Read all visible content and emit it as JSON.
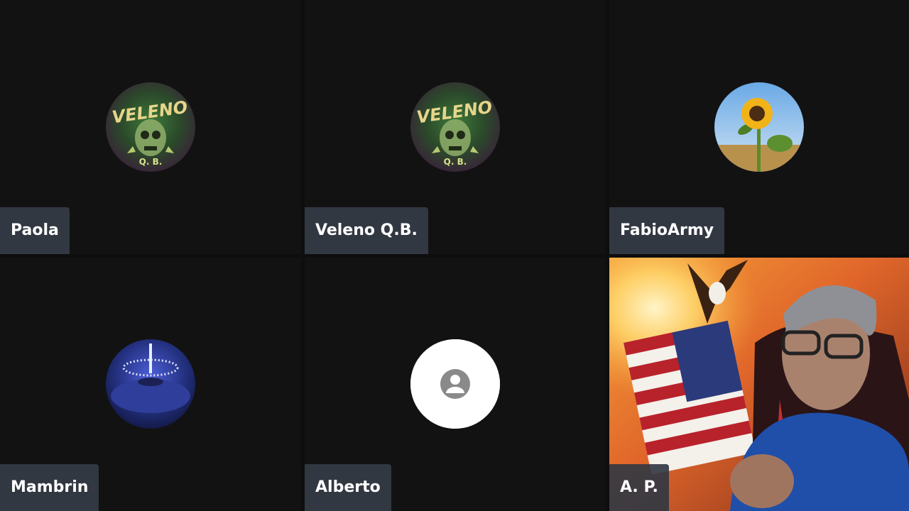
{
  "participants": [
    {
      "name": "Paola",
      "avatar": "veleno-skull-logo-avatar",
      "logo_text": "VELENO",
      "logo_sub": "Q. B."
    },
    {
      "name": "Veleno Q.B.",
      "avatar": "veleno-skull-logo-avatar",
      "logo_text": "VELENO",
      "logo_sub": "Q. B."
    },
    {
      "name": "FabioArmy",
      "avatar": "sunflower-avatar"
    },
    {
      "name": "Mambrin",
      "avatar": "blue-fountain-avatar"
    },
    {
      "name": "Alberto",
      "avatar": "default-user-avatar"
    },
    {
      "name": "A. P.",
      "avatar": "live-camera-video"
    }
  ],
  "colors": {
    "background": "#0e0e0f",
    "tile": "#121212",
    "name_tag": "#323842",
    "name_text": "#ffffff"
  }
}
